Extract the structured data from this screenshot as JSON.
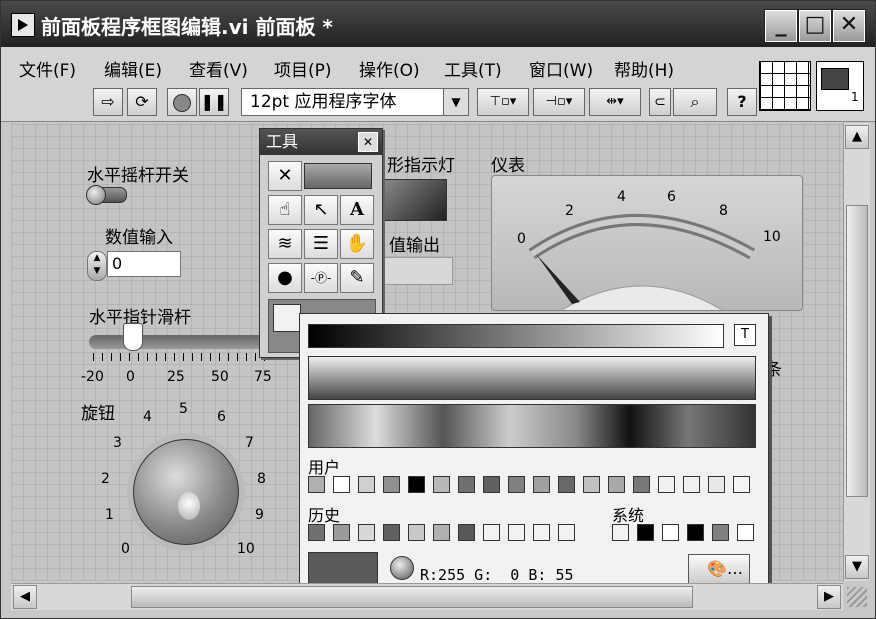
{
  "window": {
    "title": "前面板程序框图编辑.vi 前面板 *",
    "controls": {
      "minimize": "_",
      "maximize": "□",
      "close": "✕"
    }
  },
  "menu": {
    "items": [
      "文件(F)",
      "编辑(E)",
      "查看(V)",
      "项目(P)",
      "操作(O)",
      "工具(T)",
      "窗口(W)",
      "帮助(H)"
    ]
  },
  "toolbar": {
    "font": "12pt 应用程序字体",
    "icons": [
      "run-arrow-icon",
      "run-continuous-icon",
      "abort-icon",
      "pause-icon",
      "align-icon",
      "distribute-icon",
      "resize-icon",
      "reorder-icon",
      "search-icon",
      "help-icon"
    ],
    "help_label": "?"
  },
  "vi_icon": {
    "badge": "1"
  },
  "front_panel": {
    "toggle_label": "水平摇杆开关",
    "numeric_label": "数值输入",
    "numeric_value": "0",
    "slider_label": "水平指针滑杆",
    "slider_ticks": [
      "-20",
      "0",
      "25",
      "50",
      "75"
    ],
    "knob_label": "旋钮",
    "knob_ticks": [
      "0",
      "1",
      "2",
      "3",
      "4",
      "5",
      "6",
      "7",
      "8",
      "9",
      "10"
    ],
    "led_label": "形指示灯",
    "numeric_out_label": "值输出",
    "meter_label": "仪表",
    "meter_ticks": [
      "0",
      "2",
      "4",
      "6",
      "8",
      "10"
    ],
    "partial_label": "条"
  },
  "tools_palette": {
    "title": "工具",
    "close": "✕",
    "tools": [
      "auto-select-icon",
      "auto-tool-indicator",
      "operate-hand-icon",
      "position-arrow-icon",
      "text-edit-icon",
      "wiring-icon",
      "shortcut-menu-icon",
      "scroll-hand-icon",
      "breakpoint-icon",
      "probe-icon",
      "color-picker-icon"
    ]
  },
  "color_picker": {
    "transparent_label": "T",
    "user_label": "用户",
    "history_label": "历史",
    "system_label": "系统",
    "rgb_text": "R:255 G:  0 B: 55",
    "more_button": "…",
    "user_colors": [
      "#b0b0b0",
      "#ffffff",
      "#d0d0d0",
      "#909090",
      "#000000",
      "#b8b8b8",
      "#707070",
      "#606060",
      "#808080",
      "#a0a0a0",
      "#686868",
      "#c0c0c0",
      "#a8a8a8",
      "#787878",
      "#f0f0f0",
      "#f0f0f0",
      "#e8e8e8",
      "#f4f4f4"
    ],
    "history_colors": [
      "#707070",
      "#9a9a9a",
      "#d8d8d8",
      "#606060",
      "#c8c8c8",
      "#b0b0b0",
      "#585858",
      "#f2f2f2",
      "#f2f2f2",
      "#f2f2f2",
      "#f2f2f2"
    ],
    "system_colors": [
      "#f2f2f2",
      "#000000",
      "#ffffff",
      "#000000",
      "#808080",
      "#ffffff"
    ],
    "current_color": "#5a5a5a"
  }
}
